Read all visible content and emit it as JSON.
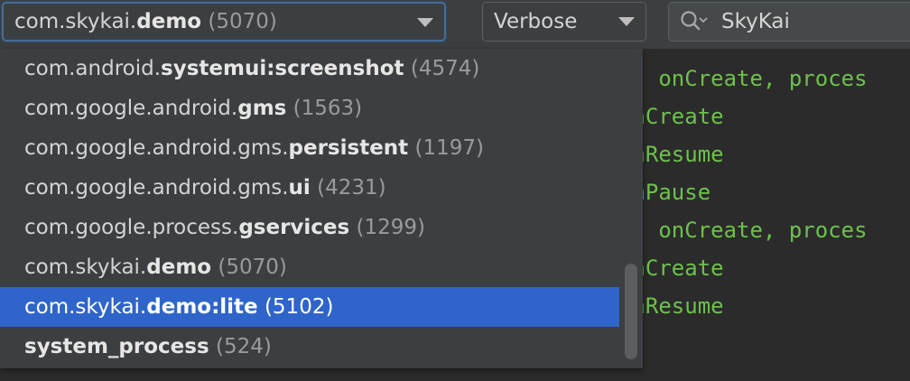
{
  "toolbar": {
    "process_combo": {
      "prefix": "com.skykai.",
      "bold": "demo",
      "pid": "(5070)",
      "icon": "chevron-down-icon"
    },
    "level_combo": {
      "value": "Verbose",
      "icon": "chevron-down-icon"
    },
    "search": {
      "value": "SkyKai",
      "icon": "search-icon"
    }
  },
  "process_list": {
    "items": [
      {
        "prefix": "com.android.",
        "bold": "systemui:screenshot",
        "pid": "(4574)",
        "selected": false
      },
      {
        "prefix": "com.google.android.",
        "bold": "gms",
        "pid": "(1563)",
        "selected": false
      },
      {
        "prefix": "com.google.android.gms.",
        "bold": "persistent",
        "pid": "(1197)",
        "selected": false
      },
      {
        "prefix": "com.google.android.gms.",
        "bold": "ui",
        "pid": "(4231)",
        "selected": false
      },
      {
        "prefix": "com.google.process.",
        "bold": "gservices",
        "pid": "(1299)",
        "selected": false
      },
      {
        "prefix": "com.skykai.",
        "bold": "demo",
        "pid": "(5070)",
        "selected": false
      },
      {
        "prefix": "com.skykai.",
        "bold": "demo:lite",
        "pid": "(5102)",
        "selected": true
      },
      {
        "prefix": "",
        "bold": "system_process",
        "pid": "(524)",
        "selected": false
      }
    ]
  },
  "log": {
    "lines": [
      "n: onCreate, proces",
      "onCreate",
      "onResume",
      "onPause",
      "n: onCreate, proces",
      "onCreate",
      "onResume"
    ]
  },
  "colors": {
    "toolbar_bg": "#3c3f41",
    "log_bg": "#2b2b2b",
    "log_text": "#6cc24a",
    "selection": "#2f65ca",
    "focus_border": "#466d94"
  }
}
